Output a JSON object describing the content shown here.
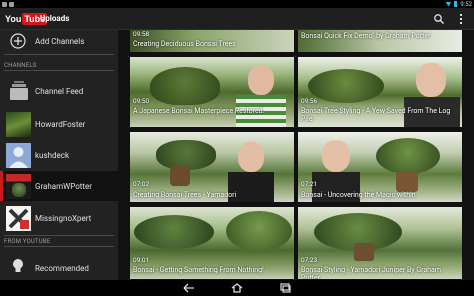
{
  "statusbar": {
    "time": "9:52"
  },
  "actionbar": {
    "logo_you": "You",
    "logo_tube": "Tube",
    "title": "Uploads"
  },
  "sidebar": {
    "add_channels": "Add Channels",
    "section_channels": "CHANNELS",
    "items": [
      {
        "label": "Channel Feed"
      },
      {
        "label": "HowardFoster"
      },
      {
        "label": "kushdeck"
      },
      {
        "label": "GrahamWPotter"
      },
      {
        "label": "MissingnoXpert"
      }
    ],
    "section_youtube": "FROM YOUTUBE",
    "recommended": "Recommended"
  },
  "videos": [
    {
      "duration": "09:58",
      "title": "Creating Deciduous Bonsai Trees"
    },
    {
      "duration": "",
      "title": "Bonsai Quick Fix Demo\" by Graham Potter"
    },
    {
      "duration": "09:50",
      "title": "A Japanese Bonsai Masterpiece Restored."
    },
    {
      "duration": "09:56",
      "title": "Bonsai Tree Styling - A Yew Saved From The Log Pile"
    },
    {
      "duration": "07:02",
      "title": "Creating Bonsai Trees - Yamadori"
    },
    {
      "duration": "07:21",
      "title": "Bonsai - Uncovering the Magic within"
    },
    {
      "duration": "09:01",
      "title": "Bonsai - Getting Something From Nothing!"
    },
    {
      "duration": "07:23",
      "title": "Bonsai Styling - Yamadori Juniper By Graham Potter"
    }
  ],
  "colors": {
    "accent": "#cc181e",
    "holo_blue": "#33b5e5"
  }
}
